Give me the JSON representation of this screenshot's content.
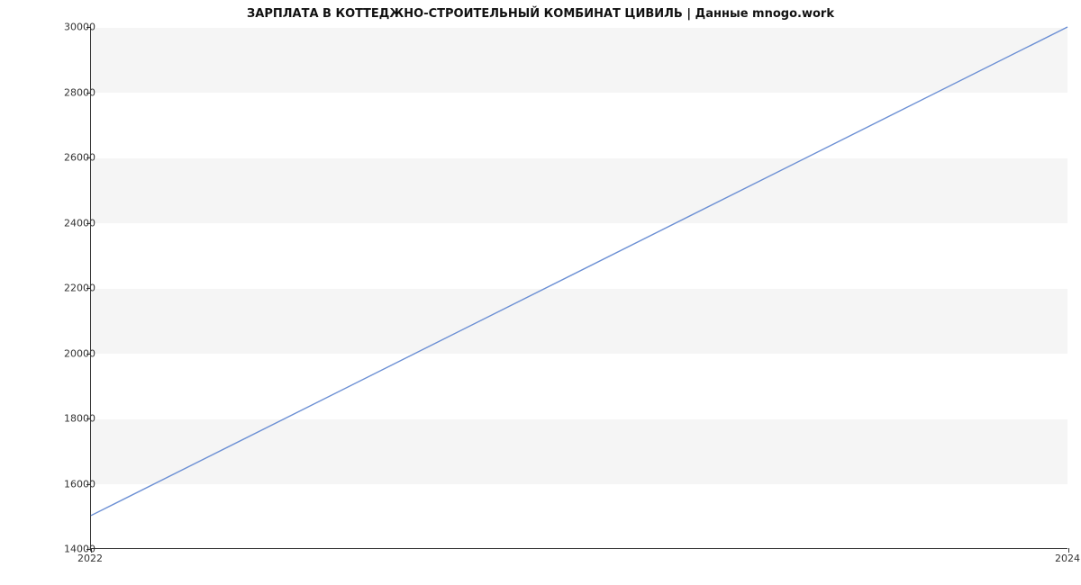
{
  "chart_data": {
    "type": "line",
    "title": "ЗАРПЛАТА В  КОТТЕДЖНО-СТРОИТЕЛЬНЫЙ КОМБИНАТ ЦИВИЛЬ | Данные mnogo.work",
    "x": [
      2022,
      2024
    ],
    "y": [
      15000,
      30000
    ],
    "xlim": [
      2022,
      2024
    ],
    "ylim": [
      14000,
      30000
    ],
    "xticks": [
      2022,
      2024
    ],
    "yticks": [
      14000,
      16000,
      18000,
      20000,
      22000,
      24000,
      26000,
      28000,
      30000
    ],
    "line_color": "#6b8fd4"
  }
}
